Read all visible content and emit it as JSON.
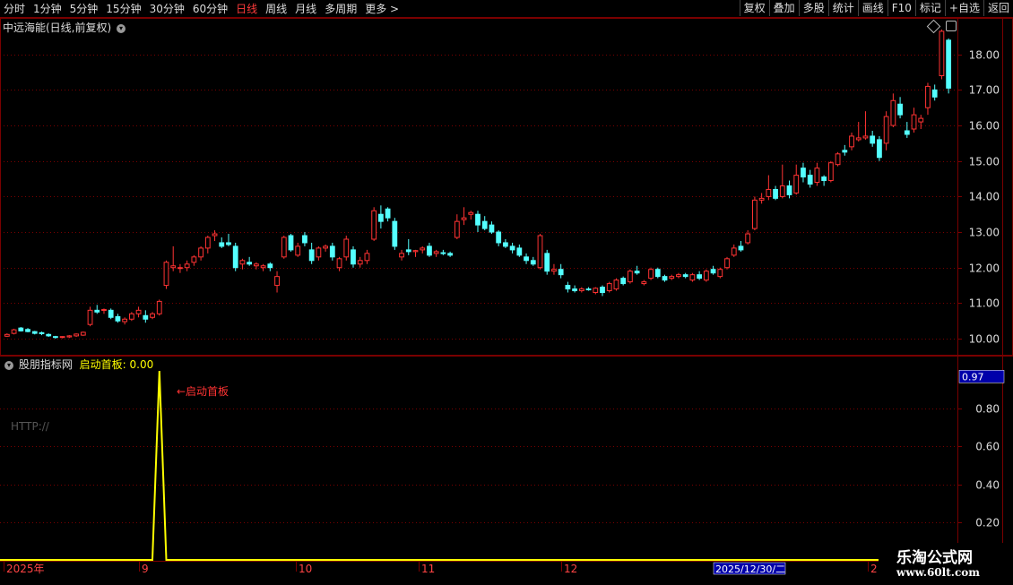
{
  "toolbar": {
    "periods": [
      "分时",
      "1分钟",
      "5分钟",
      "15分钟",
      "30分钟",
      "60分钟",
      "日线",
      "周线",
      "月线",
      "多周期",
      "更多 >"
    ],
    "active_period": "日线",
    "right_buttons": [
      "复权",
      "叠加",
      "多股",
      "统计",
      "画线",
      "F10",
      "标记",
      "+自选",
      "返回"
    ]
  },
  "main_pane": {
    "title": "中远海能(日线,前复权)",
    "y_ticks": [
      "18.00",
      "17.00",
      "16.00",
      "15.00",
      "14.00",
      "13.00",
      "12.00",
      "11.00",
      "10.00"
    ]
  },
  "indicator_pane": {
    "name": "股朋指标网",
    "series_label": "启动首板: 0.00",
    "annotation": "←启动首板",
    "watermark": "HTTP://",
    "current_value": "0.97",
    "y_ticks": [
      "0.80",
      "0.60",
      "0.40",
      "0.20"
    ]
  },
  "x_axis": {
    "labels": [
      "2025年",
      "9",
      "10",
      "11",
      "12",
      "2"
    ],
    "cursor_date": "2025/12/30/二"
  },
  "branding": {
    "line1": "乐淘公式网",
    "line2": "www.60lt.com"
  },
  "colors": {
    "up": "#ff3333",
    "down": "#54ffff",
    "grid": "#7a0000",
    "signal": "#ffff00",
    "active_period": "#ff3b3b"
  },
  "chart_data": [
    {
      "type": "candlestick",
      "title": "中远海能(日线,前复权)",
      "ylim": [
        9.8,
        18.9
      ],
      "x_labels": [
        "2025年",
        "9",
        "10",
        "11",
        "12",
        "2"
      ],
      "ohlc": [
        [
          10.07,
          10.15,
          10.05,
          10.12
        ],
        [
          10.15,
          10.28,
          10.12,
          10.25
        ],
        [
          10.3,
          10.33,
          10.2,
          10.22
        ],
        [
          10.26,
          10.3,
          10.18,
          10.2
        ],
        [
          10.2,
          10.22,
          10.12,
          10.15
        ],
        [
          10.17,
          10.2,
          10.1,
          10.14
        ],
        [
          10.12,
          10.15,
          10.05,
          10.08
        ],
        [
          10.06,
          10.08,
          10.0,
          10.04
        ],
        [
          10.04,
          10.07,
          10.01,
          10.06
        ],
        [
          10.05,
          10.1,
          10.02,
          10.08
        ],
        [
          10.08,
          10.15,
          10.05,
          10.13
        ],
        [
          10.1,
          10.2,
          10.08,
          10.18
        ],
        [
          10.4,
          10.9,
          10.35,
          10.8
        ],
        [
          10.8,
          10.95,
          10.7,
          10.75
        ],
        [
          10.8,
          10.85,
          10.7,
          10.82
        ],
        [
          10.8,
          10.85,
          10.55,
          10.6
        ],
        [
          10.62,
          10.7,
          10.45,
          10.5
        ],
        [
          10.48,
          10.6,
          10.4,
          10.55
        ],
        [
          10.55,
          10.75,
          10.5,
          10.7
        ],
        [
          10.7,
          10.9,
          10.6,
          10.8
        ],
        [
          10.65,
          10.8,
          10.45,
          10.55
        ],
        [
          10.6,
          10.75,
          10.55,
          10.7
        ],
        [
          10.7,
          11.1,
          10.65,
          11.05
        ],
        [
          11.5,
          12.2,
          11.4,
          12.15
        ],
        [
          12.0,
          12.6,
          11.9,
          12.05
        ],
        [
          12.0,
          12.1,
          11.85,
          12.0
        ],
        [
          12.0,
          12.2,
          11.9,
          12.1
        ],
        [
          12.15,
          12.35,
          12.05,
          12.3
        ],
        [
          12.3,
          12.6,
          12.2,
          12.55
        ],
        [
          12.55,
          12.9,
          12.4,
          12.85
        ],
        [
          12.9,
          13.05,
          12.75,
          12.95
        ],
        [
          12.7,
          12.85,
          12.55,
          12.6
        ],
        [
          12.7,
          12.95,
          12.6,
          12.65
        ],
        [
          12.6,
          12.7,
          11.9,
          12.0
        ],
        [
          12.1,
          12.25,
          11.95,
          12.2
        ],
        [
          12.15,
          12.3,
          12.05,
          12.1
        ],
        [
          12.05,
          12.15,
          11.95,
          12.1
        ],
        [
          12.0,
          12.1,
          11.9,
          12.05
        ],
        [
          12.1,
          12.15,
          11.9,
          12.0
        ],
        [
          11.5,
          11.9,
          11.3,
          11.75
        ],
        [
          12.3,
          12.9,
          12.25,
          12.85
        ],
        [
          12.9,
          12.95,
          12.45,
          12.5
        ],
        [
          12.35,
          12.7,
          12.3,
          12.6
        ],
        [
          12.9,
          13.0,
          12.6,
          12.7
        ],
        [
          12.5,
          12.7,
          12.1,
          12.2
        ],
        [
          12.3,
          12.6,
          12.2,
          12.55
        ],
        [
          12.55,
          12.65,
          12.45,
          12.6
        ],
        [
          12.6,
          12.7,
          12.2,
          12.3
        ],
        [
          12.0,
          12.3,
          11.9,
          12.25
        ],
        [
          12.3,
          12.9,
          12.2,
          12.8
        ],
        [
          12.5,
          12.6,
          12.0,
          12.1
        ],
        [
          12.1,
          12.3,
          12.0,
          12.2
        ],
        [
          12.2,
          12.5,
          12.1,
          12.4
        ],
        [
          12.8,
          13.7,
          12.75,
          13.6
        ],
        [
          13.5,
          13.75,
          13.1,
          13.3
        ],
        [
          13.65,
          13.7,
          13.3,
          13.4
        ],
        [
          13.3,
          13.4,
          12.5,
          12.6
        ],
        [
          12.3,
          12.5,
          12.2,
          12.4
        ],
        [
          12.5,
          12.8,
          12.35,
          12.45
        ],
        [
          12.45,
          12.5,
          12.3,
          12.48
        ],
        [
          12.5,
          12.6,
          12.4,
          12.55
        ],
        [
          12.6,
          12.7,
          12.3,
          12.35
        ],
        [
          12.4,
          12.5,
          12.3,
          12.45
        ],
        [
          12.42,
          12.5,
          12.35,
          12.4
        ],
        [
          12.4,
          12.45,
          12.3,
          12.35
        ],
        [
          12.85,
          13.5,
          12.8,
          13.3
        ],
        [
          13.35,
          13.7,
          13.2,
          13.4
        ],
        [
          13.5,
          13.6,
          13.35,
          13.55
        ],
        [
          13.5,
          13.6,
          13.0,
          13.2
        ],
        [
          13.3,
          13.45,
          13.05,
          13.1
        ],
        [
          13.2,
          13.3,
          12.95,
          13.0
        ],
        [
          13.0,
          13.05,
          12.6,
          12.7
        ],
        [
          12.7,
          12.8,
          12.55,
          12.6
        ],
        [
          12.6,
          12.7,
          12.4,
          12.5
        ],
        [
          12.55,
          12.65,
          12.3,
          12.35
        ],
        [
          12.3,
          12.4,
          12.1,
          12.2
        ],
        [
          12.2,
          12.3,
          12.05,
          12.1
        ],
        [
          12.0,
          12.95,
          11.95,
          12.9
        ],
        [
          12.4,
          12.5,
          11.8,
          11.9
        ],
        [
          11.9,
          12.1,
          11.8,
          11.95
        ],
        [
          11.95,
          12.1,
          11.7,
          11.8
        ],
        [
          11.5,
          11.6,
          11.3,
          11.4
        ],
        [
          11.4,
          11.5,
          11.3,
          11.35
        ],
        [
          11.35,
          11.45,
          11.3,
          11.4
        ],
        [
          11.4,
          11.45,
          11.35,
          11.38
        ],
        [
          11.3,
          11.45,
          11.25,
          11.42
        ],
        [
          11.45,
          11.5,
          11.2,
          11.3
        ],
        [
          11.35,
          11.6,
          11.3,
          11.55
        ],
        [
          11.4,
          11.7,
          11.35,
          11.65
        ],
        [
          11.7,
          11.75,
          11.5,
          11.55
        ],
        [
          11.6,
          11.95,
          11.55,
          11.9
        ],
        [
          11.9,
          12.05,
          11.8,
          11.85
        ],
        [
          11.55,
          11.65,
          11.5,
          11.6
        ],
        [
          11.7,
          12.0,
          11.65,
          11.95
        ],
        [
          11.95,
          12.0,
          11.7,
          11.75
        ],
        [
          11.75,
          11.8,
          11.6,
          11.65
        ],
        [
          11.7,
          11.8,
          11.65,
          11.75
        ],
        [
          11.75,
          11.85,
          11.7,
          11.8
        ],
        [
          11.8,
          11.85,
          11.7,
          11.75
        ],
        [
          11.65,
          11.85,
          11.6,
          11.8
        ],
        [
          11.8,
          11.9,
          11.65,
          11.7
        ],
        [
          11.65,
          11.95,
          11.6,
          11.9
        ],
        [
          11.95,
          12.05,
          11.8,
          11.85
        ],
        [
          11.75,
          12.0,
          11.7,
          11.95
        ],
        [
          12.0,
          12.3,
          11.95,
          12.25
        ],
        [
          12.35,
          12.65,
          12.3,
          12.55
        ],
        [
          12.6,
          12.75,
          12.45,
          12.5
        ],
        [
          12.7,
          13.05,
          12.65,
          12.95
        ],
        [
          13.1,
          14.0,
          13.05,
          13.9
        ],
        [
          13.9,
          14.1,
          13.8,
          13.95
        ],
        [
          14.0,
          14.6,
          13.9,
          14.2
        ],
        [
          14.2,
          14.3,
          13.9,
          13.95
        ],
        [
          14.0,
          14.9,
          13.95,
          14.3
        ],
        [
          14.3,
          14.45,
          13.95,
          14.05
        ],
        [
          14.1,
          14.9,
          14.05,
          14.6
        ],
        [
          14.8,
          14.95,
          14.4,
          14.55
        ],
        [
          14.6,
          14.75,
          14.25,
          14.35
        ],
        [
          14.4,
          14.95,
          14.3,
          14.8
        ],
        [
          14.55,
          14.6,
          14.3,
          14.45
        ],
        [
          14.45,
          15.0,
          14.4,
          14.95
        ],
        [
          14.9,
          15.25,
          14.85,
          15.2
        ],
        [
          15.3,
          15.45,
          15.15,
          15.25
        ],
        [
          15.4,
          15.8,
          15.3,
          15.7
        ],
        [
          15.6,
          16.1,
          15.55,
          15.65
        ],
        [
          15.65,
          16.4,
          15.6,
          15.7
        ],
        [
          15.7,
          15.85,
          15.4,
          15.5
        ],
        [
          15.6,
          15.7,
          15.0,
          15.1
        ],
        [
          15.5,
          16.4,
          15.3,
          16.25
        ],
        [
          16.0,
          16.9,
          15.95,
          16.7
        ],
        [
          16.6,
          16.8,
          16.2,
          16.3
        ],
        [
          15.85,
          16.1,
          15.65,
          15.75
        ],
        [
          15.9,
          16.5,
          15.8,
          16.3
        ],
        [
          16.1,
          16.3,
          15.9,
          16.2
        ],
        [
          16.5,
          17.2,
          16.3,
          17.1
        ],
        [
          17.0,
          17.15,
          16.7,
          16.8
        ],
        [
          17.4,
          18.7,
          17.3,
          18.65
        ],
        [
          18.4,
          18.45,
          16.9,
          17.05
        ]
      ]
    },
    {
      "type": "line",
      "name": "启动首板",
      "ylim": [
        0,
        1.0
      ],
      "values": [
        0,
        0,
        0,
        0,
        0,
        0,
        0,
        0,
        0,
        0,
        0,
        0,
        0,
        0,
        0,
        0,
        0,
        0,
        0,
        0,
        0,
        0,
        1,
        0,
        0,
        0,
        0,
        0,
        0,
        0,
        0,
        0,
        0,
        0,
        0,
        0,
        0,
        0,
        0,
        0,
        0,
        0,
        0,
        0,
        0,
        0,
        0,
        0,
        0,
        0,
        0,
        0,
        0,
        0,
        0,
        0,
        0,
        0,
        0,
        0,
        0,
        0,
        0,
        0,
        0,
        0,
        0,
        0,
        0,
        0,
        0,
        0,
        0,
        0,
        0,
        0,
        0,
        0,
        0,
        0,
        0,
        0,
        0,
        0,
        0,
        0,
        0,
        0,
        0,
        0,
        0,
        0,
        0,
        0,
        0,
        0,
        0,
        0,
        0,
        0,
        0,
        0,
        0,
        0,
        0,
        0,
        0,
        0,
        0,
        0,
        0,
        0,
        0,
        0,
        0,
        0,
        0,
        0,
        0,
        0,
        0,
        0,
        0,
        0,
        0,
        0,
        0,
        0,
        0,
        0,
        0,
        0,
        0,
        0,
        0,
        0,
        0,
        0,
        0,
        0,
        0,
        0,
        0,
        0,
        0
      ]
    }
  ]
}
